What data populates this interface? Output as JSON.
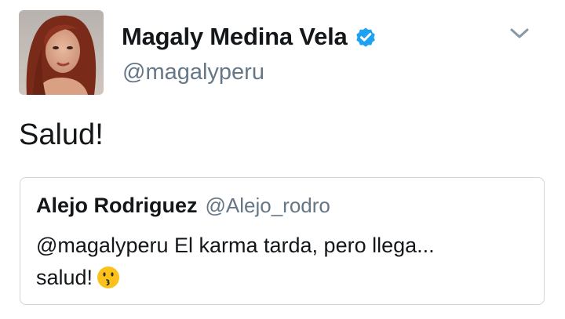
{
  "tweet": {
    "author": {
      "display_name": "Magaly Medina Vela",
      "handle": "@magalyperu",
      "verified_icon": "verified-badge-icon"
    },
    "menu_icon": "chevron-down-icon",
    "text": "Salud!",
    "quoted": {
      "display_name": "Alejo Rodriguez",
      "handle": "@Alejo_rodro",
      "text_line1": "@magalyperu El karma tarda, pero llega...",
      "text_line2": "salud!",
      "emoji_icon": "kissing-face-emoji-icon"
    }
  },
  "colors": {
    "text": "#14171a",
    "secondary": "#657786",
    "verified": "#1da1f2",
    "border": "#ccd6dd"
  }
}
